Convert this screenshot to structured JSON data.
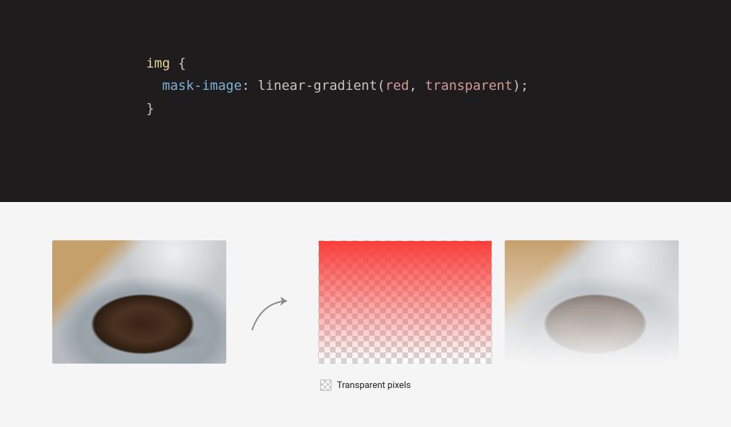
{
  "code": {
    "selector": "img",
    "open_brace": "{",
    "property": "mask-image",
    "colon": ":",
    "func": "linear-gradient",
    "open_paren": "(",
    "arg1": "red",
    "sep": ",",
    "arg2": "transparent",
    "close_paren": ")",
    "semicolon": ";",
    "close_brace": "}"
  },
  "legend": {
    "label": "Transparent pixels"
  }
}
